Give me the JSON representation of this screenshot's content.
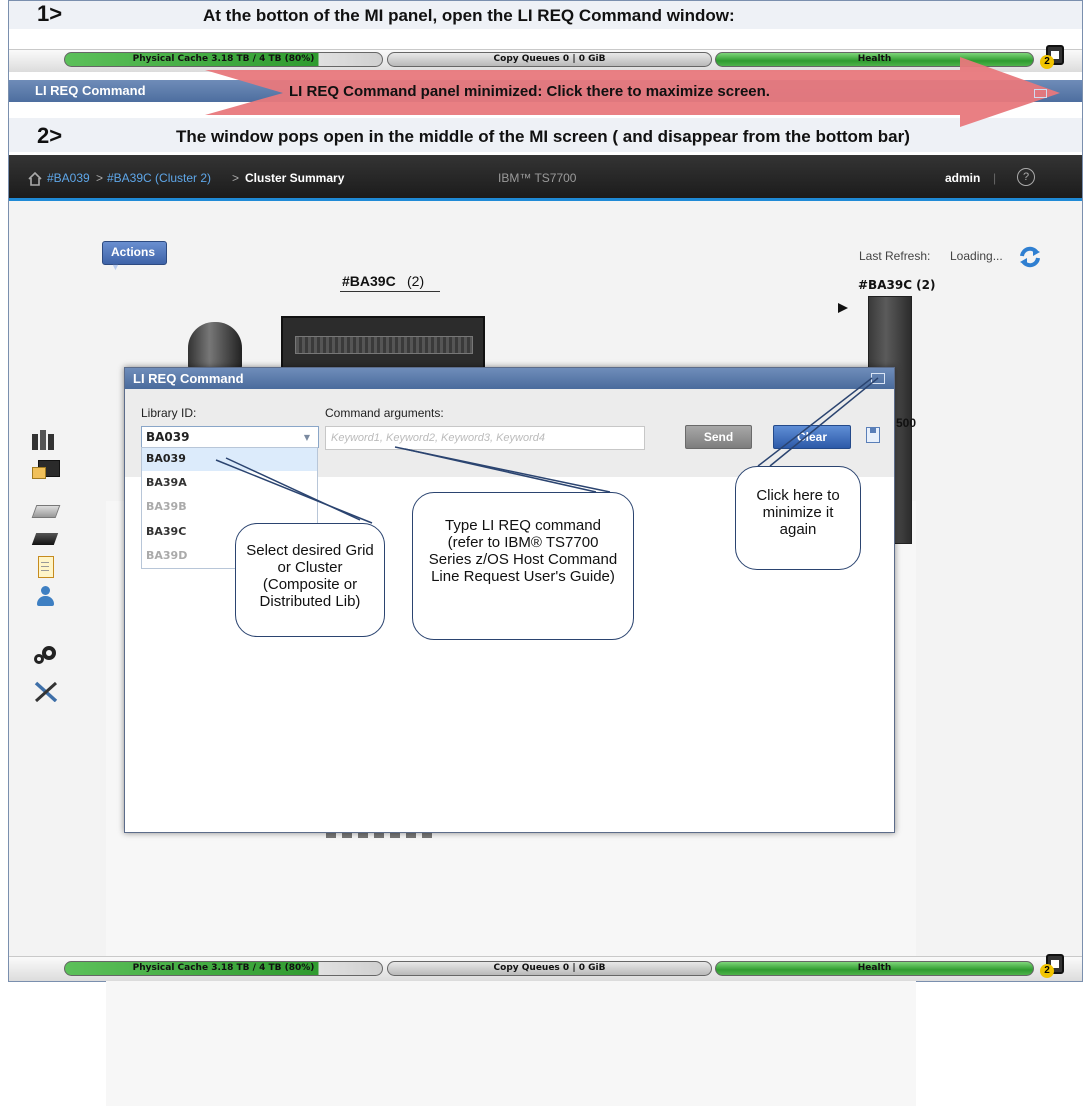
{
  "steps": {
    "step1_number": "1>",
    "step1_text": "At the botton of the MI panel, open the LI REQ Command window:",
    "step2_number": "2>",
    "step2_text": "The window pops open in the middle of the MI screen ( and disappear from the bottom bar)"
  },
  "statusbar": {
    "cache_label": "Physical Cache 3.18 TB / 4 TB (80%)",
    "cache_fill": 0.8,
    "copy_queues_label": "Copy Queues 0 | 0 GiB",
    "health_label": "Health",
    "alert_count": "2"
  },
  "minimized_panel": {
    "label": "LI REQ Command",
    "arrow_text": "LI REQ Command panel minimized: Click there to maximize screen."
  },
  "header": {
    "crumb_root": "#BA039",
    "crumb_sep1": ">",
    "crumb_cluster": "#BA39C (Cluster 2)",
    "crumb_sep2": ">",
    "crumb_current": "Cluster Summary",
    "product": "IBM™ TS7700",
    "user": "admin",
    "help": "?"
  },
  "content": {
    "actions_label": "Actions",
    "cluster_title": "#BA39C",
    "cluster_number": "(2)",
    "last_refresh_label": "Last Refresh:",
    "last_refresh_value": "Loading...",
    "mini_cluster_title": "#BA39C (2)",
    "partial_label": "500"
  },
  "sidebar_icons": [
    "clusters-icon",
    "monitor-icon",
    "virtual-drive-icon",
    "physical-drive-icon",
    "clipboard-icon",
    "user-icon",
    "gears-icon",
    "tools-icon"
  ],
  "dialog": {
    "title": "LI REQ Command",
    "library_id_label": "Library ID:",
    "library_id_value": "BA039",
    "command_args_label": "Command arguments:",
    "command_args_placeholder": "Keyword1, Keyword2, Keyword3, Keyword4",
    "send_label": "Send",
    "clear_label": "Clear",
    "library_options": [
      {
        "label": "BA039",
        "enabled": true,
        "selected": true
      },
      {
        "label": "BA39A",
        "enabled": true,
        "selected": false
      },
      {
        "label": "BA39B",
        "enabled": false,
        "selected": false
      },
      {
        "label": "BA39C",
        "enabled": true,
        "selected": false
      },
      {
        "label": "BA39D",
        "enabled": false,
        "selected": false
      }
    ]
  },
  "callouts": {
    "select": "Select desired Grid or Cluster (Composite or Distributed Lib)",
    "type": "Type LI REQ command (refer to IBM® TS7700 Series z/OS Host Command Line Request User's Guide)",
    "minimize": "Click here to minimize it again"
  },
  "colors": {
    "accent_blue": "#1f8ad6",
    "panel_blue": "#4d6e9f",
    "arrow_red": "#e8787c",
    "status_green": "#2f9b2f"
  }
}
